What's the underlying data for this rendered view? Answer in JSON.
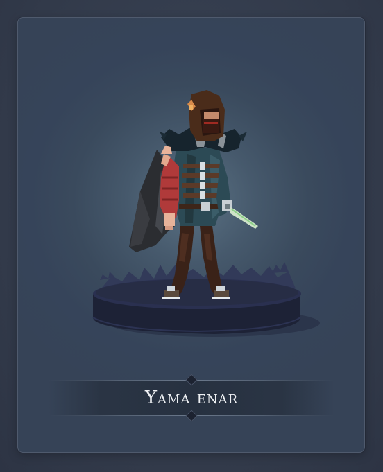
{
  "character": {
    "name": "Yama enar"
  },
  "colors": {
    "background": "#343d4d",
    "card_glow": "#5b7284",
    "pedestal_top": "#272d45",
    "pedestal_side": "#1d2236",
    "cloak": "#2f3134",
    "hood": "#4a2c1a",
    "armor_teal": "#2c4a55",
    "sleeve_red": "#b03a3a",
    "blade_green": "#8fd08a",
    "name_text": "#eef0f3"
  }
}
